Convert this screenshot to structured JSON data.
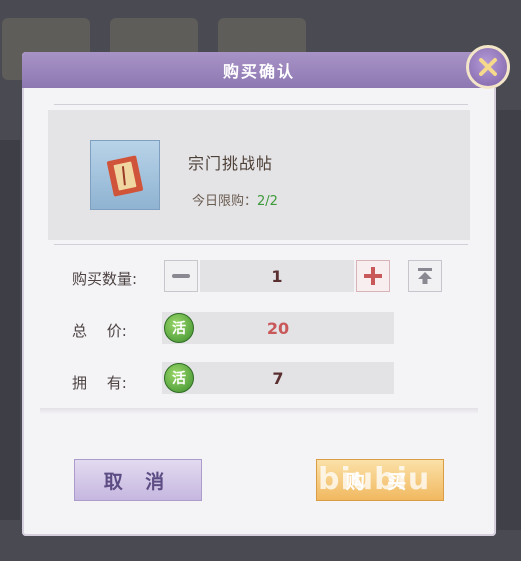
{
  "dialog": {
    "title": "购买确认",
    "close_icon": "close-x-icon"
  },
  "item": {
    "name": "宗门挑战帖",
    "icon": "challenge-letter-icon",
    "limit_label": "今日限购：",
    "limit_value": "2/2"
  },
  "purchase": {
    "quantity_label": "购买数量:",
    "quantity_value": "1",
    "decrease_icon": "minus-icon",
    "increase_icon": "plus-icon",
    "max_icon": "max-arrow-icon",
    "total_label": "总　 价:",
    "total_value": "20",
    "owned_label": "拥　 有:",
    "owned_value": "7",
    "currency_glyph": "活",
    "currency_icon": "activity-coin-icon"
  },
  "buttons": {
    "cancel_label": "取 消",
    "buy_label": "购 买"
  },
  "watermark": "biubiu",
  "colors": {
    "accent_purple": "#8e78b2",
    "value_red": "#c9585a",
    "value_dark": "#5a2f2f",
    "limit_green": "#3d9a3a",
    "buy_gold": "#f1b960"
  }
}
